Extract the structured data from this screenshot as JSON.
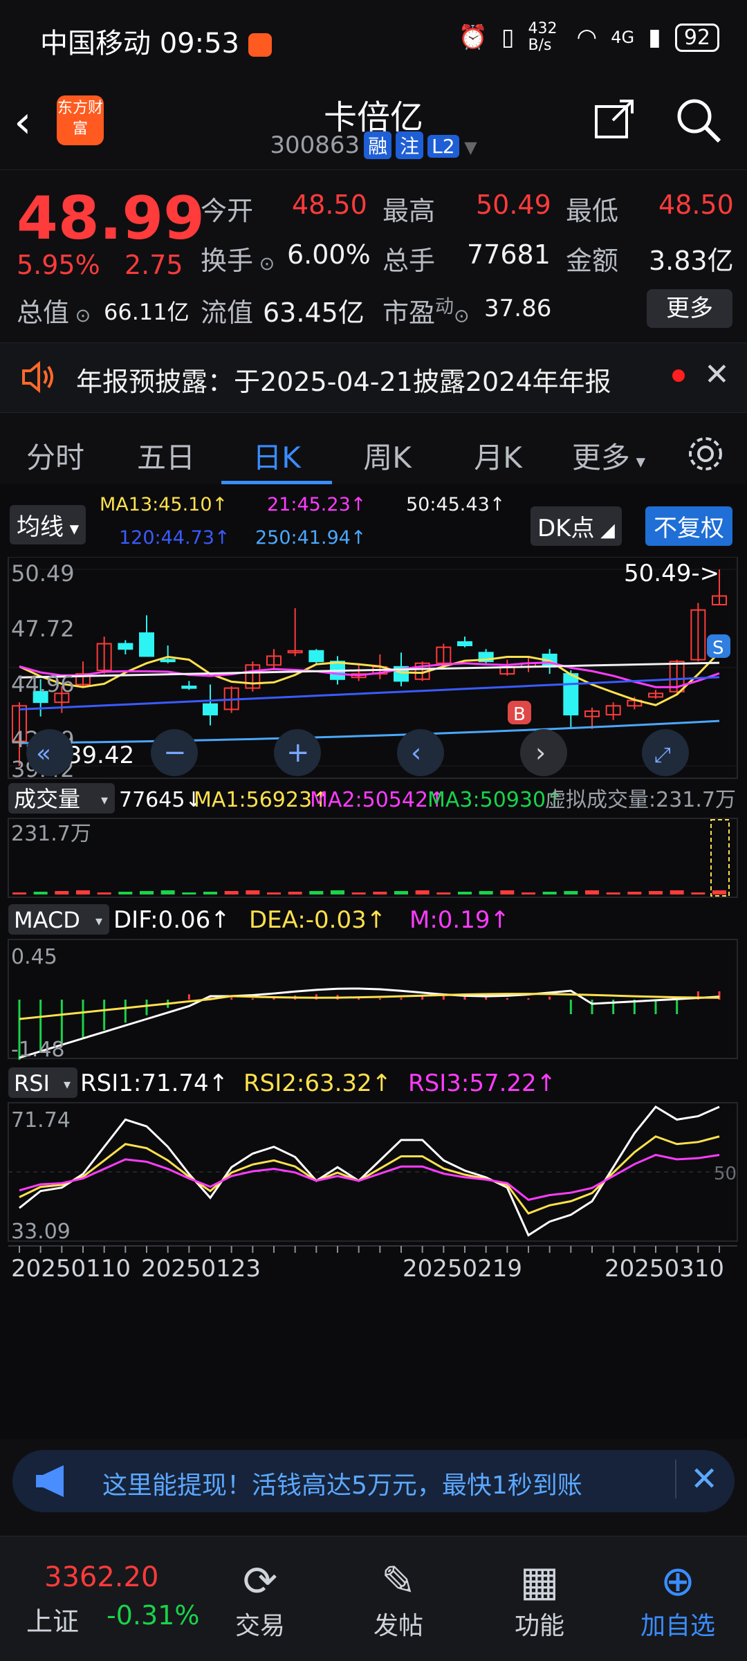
{
  "status_bar": {
    "carrier": "中国移动",
    "time": "09:53",
    "net_speed": "432 B/s",
    "network": "4G",
    "battery": "92"
  },
  "header": {
    "title": "卡倍亿",
    "code": "300863",
    "badges": [
      "融",
      "注",
      "L2"
    ],
    "logo_text": "东方财富"
  },
  "quote": {
    "price": "48.99",
    "change_pct": "5.95%",
    "change": "2.75",
    "open_label": "今开",
    "open": "48.50",
    "high_label": "最高",
    "high": "50.49",
    "low_label": "最低",
    "low": "48.50",
    "turnover_label": "换手",
    "turnover": "6.00%",
    "volume_label": "总手",
    "volume": "77681",
    "amount_label": "金额",
    "amount": "3.83亿",
    "mktcap_label": "总值",
    "mktcap": "66.11亿",
    "float_label": "流值",
    "float_cap": "63.45亿",
    "pe_label": "市盈",
    "pe_tag": "动",
    "pe": "37.86",
    "more_label": "更多"
  },
  "notice": {
    "text": "年报预披露：于2025-04-21披露2024年年报"
  },
  "tabs": [
    "分时",
    "五日",
    "日K",
    "周K",
    "月K",
    "更多"
  ],
  "active_tab": "日K",
  "kline": {
    "indicator_label": "均线",
    "ma13": "MA13:45.10↑",
    "ma21": "21:45.23↑",
    "ma50": "50:45.43↑",
    "ma120": "120:44.73↑",
    "ma250": "250:41.94↑",
    "dk_label": "DK点",
    "adjust_label": "不复权",
    "y_ticks": [
      "50.49",
      "47.72",
      "44.96",
      "42.19",
      "39.42"
    ],
    "high_marker": "50.49->",
    "low_marker": "<-39.42",
    "buy_tag": "B",
    "sell_tag": "S"
  },
  "volume_panel": {
    "label": "成交量",
    "current": "77645↓",
    "ma1": "MA1:56923↑",
    "ma2": "MA2:50542↑",
    "ma3": "MA3:50930↑",
    "virtual": "虚拟成交量:231.7万",
    "y_top": "231.7万"
  },
  "macd_panel": {
    "label": "MACD",
    "dif": "DIF:0.06↑",
    "dea": "DEA:-0.03↑",
    "m": "M:0.19↑",
    "y_top": "0.45",
    "y_bottom": "-1.48"
  },
  "rsi_panel": {
    "label": "RSI",
    "rsi1": "RSI1:71.74↑",
    "rsi2": "RSI2:63.32↑",
    "rsi3": "RSI3:57.22↑",
    "y_top": "71.74",
    "y_bottom": "33.09",
    "mid": "50"
  },
  "x_dates": [
    "20250110",
    "20250123",
    "20250219",
    "20250310"
  ],
  "banner": {
    "text": "这里能提现！活钱高达5万元，最快1秒到账"
  },
  "bottom_nav": {
    "index_value": "3362.20",
    "index_name": "上证",
    "index_change": "-0.31%",
    "items": [
      "交易",
      "发帖",
      "功能",
      "加自选"
    ]
  },
  "colors": {
    "up": "#ff3b3b",
    "down": "#2ef3f3",
    "ma13": "#ffe14d",
    "ma21": "#ff3cff",
    "ma50": "#f2f2f2",
    "ma120": "#3a5bff",
    "ma250": "#4aa8ff",
    "accent": "#3a8dff"
  },
  "chart_data": {
    "type": "candlestick",
    "x": [
      "20250110",
      "20250123",
      "20250219",
      "20250310"
    ],
    "candles": [
      {
        "o": 40.8,
        "h": 43.0,
        "l": 39.42,
        "c": 42.8
      },
      {
        "o": 43.6,
        "h": 44.3,
        "l": 42.2,
        "c": 43.0
      },
      {
        "o": 43.0,
        "h": 43.9,
        "l": 42.4,
        "c": 43.5
      },
      {
        "o": 44.0,
        "h": 45.3,
        "l": 43.8,
        "c": 44.6
      },
      {
        "o": 44.8,
        "h": 46.7,
        "l": 44.6,
        "c": 46.3
      },
      {
        "o": 46.3,
        "h": 46.5,
        "l": 45.7,
        "c": 46.0
      },
      {
        "o": 46.9,
        "h": 47.9,
        "l": 45.6,
        "c": 45.6
      },
      {
        "o": 45.4,
        "h": 46.2,
        "l": 45.2,
        "c": 45.3
      },
      {
        "o": 43.9,
        "h": 44.2,
        "l": 43.7,
        "c": 43.8
      },
      {
        "o": 42.9,
        "h": 44.0,
        "l": 41.7,
        "c": 42.3
      },
      {
        "o": 42.6,
        "h": 43.9,
        "l": 42.4,
        "c": 43.8
      },
      {
        "o": 43.8,
        "h": 45.3,
        "l": 43.6,
        "c": 45.1
      },
      {
        "o": 45.1,
        "h": 46.0,
        "l": 44.9,
        "c": 45.6
      },
      {
        "o": 45.8,
        "h": 48.3,
        "l": 45.6,
        "c": 45.9
      },
      {
        "o": 45.9,
        "h": 46.0,
        "l": 45.2,
        "c": 45.3
      },
      {
        "o": 45.3,
        "h": 45.6,
        "l": 44.0,
        "c": 44.3
      },
      {
        "o": 44.4,
        "h": 45.2,
        "l": 44.2,
        "c": 44.6
      },
      {
        "o": 44.6,
        "h": 45.7,
        "l": 44.3,
        "c": 45.0
      },
      {
        "o": 45.0,
        "h": 45.8,
        "l": 43.9,
        "c": 44.2
      },
      {
        "o": 44.3,
        "h": 45.3,
        "l": 44.2,
        "c": 45.2
      },
      {
        "o": 45.2,
        "h": 46.3,
        "l": 45.0,
        "c": 46.1
      },
      {
        "o": 46.4,
        "h": 46.7,
        "l": 46.1,
        "c": 46.2
      },
      {
        "o": 45.8,
        "h": 46.0,
        "l": 45.2,
        "c": 45.3
      },
      {
        "o": 44.6,
        "h": 45.4,
        "l": 44.5,
        "c": 45.0
      },
      {
        "o": 45.0,
        "h": 45.5,
        "l": 44.7,
        "c": 45.2
      },
      {
        "o": 45.7,
        "h": 46.0,
        "l": 44.6,
        "c": 45.0
      },
      {
        "o": 44.6,
        "h": 44.8,
        "l": 41.6,
        "c": 42.3
      },
      {
        "o": 42.2,
        "h": 42.7,
        "l": 41.5,
        "c": 42.5
      },
      {
        "o": 42.3,
        "h": 43.0,
        "l": 42.0,
        "c": 42.8
      },
      {
        "o": 42.8,
        "h": 43.3,
        "l": 42.6,
        "c": 43.1
      },
      {
        "o": 43.3,
        "h": 43.7,
        "l": 43.2,
        "c": 43.5
      },
      {
        "o": 43.6,
        "h": 45.4,
        "l": 43.5,
        "c": 45.3
      },
      {
        "o": 45.4,
        "h": 48.6,
        "l": 45.3,
        "c": 48.2
      },
      {
        "o": 48.5,
        "h": 50.49,
        "l": 48.5,
        "c": 48.99
      }
    ],
    "ylim": [
      39.42,
      50.49
    ],
    "volume_ylim": [
      0,
      2317000
    ],
    "macd_ylim": [
      -1.48,
      0.45
    ],
    "rsi_ylim": [
      33.09,
      71.74
    ]
  }
}
